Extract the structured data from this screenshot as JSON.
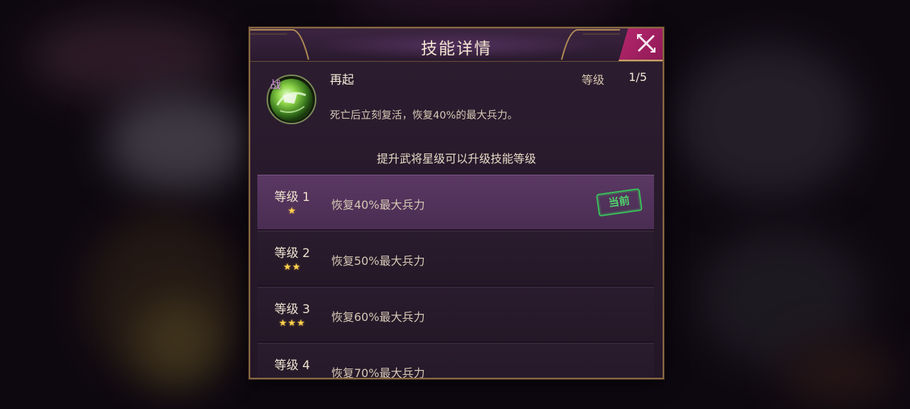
{
  "dialog": {
    "title": "技能详情",
    "close_icon": "close-icon"
  },
  "skill": {
    "icon": "skill-green-orb-icon",
    "tag": "战",
    "name": "再起",
    "level_label": "等级",
    "level_value": "1/5",
    "description": "死亡后立刻复活，恢复40%的最大兵力。"
  },
  "hint": "提升武将星级可以升级技能等级",
  "levels": [
    {
      "label": "等级 1",
      "stars": "★",
      "effect": "恢复40%最大兵力",
      "current_badge": "当前"
    },
    {
      "label": "等级 2",
      "stars": "★★",
      "effect": "恢复50%最大兵力"
    },
    {
      "label": "等级 3",
      "stars": "★★★",
      "effect": "恢复60%最大兵力"
    },
    {
      "label": "等级 4",
      "effect": "恢复70%最大兵力"
    }
  ],
  "colors": {
    "accent_magenta": "#b8276f",
    "gold_border": "#8a6a44",
    "star": "#ffd34d",
    "stamp_green": "#3bbf5a"
  }
}
